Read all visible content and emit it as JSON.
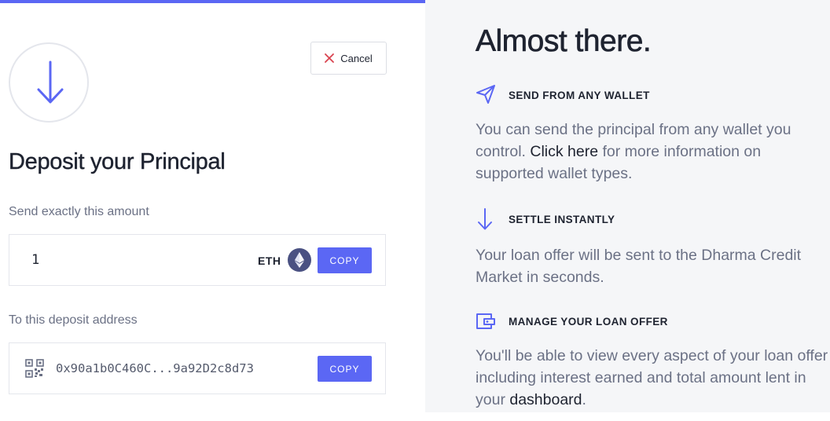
{
  "colors": {
    "accent": "#5b67f4",
    "heading": "#1e2330",
    "muted": "#6b7185",
    "right_panel_bg": "#f5f6f8",
    "cancel_icon": "#d9434f"
  },
  "deposit": {
    "icon": "arrow-down-icon",
    "cancel_label": "Cancel",
    "cancel_icon": "close-icon",
    "title": "Deposit your Principal",
    "amount_label": "Send exactly this amount",
    "amount_value": "1",
    "token_symbol": "ETH",
    "token_icon": "ethereum-icon",
    "amount_copy_label": "COPY",
    "address_label": "To this deposit address",
    "address_icon": "qr-code-icon",
    "address_value": "0x90a1b0C460C...9a92D2c8d73",
    "address_copy_label": "COPY"
  },
  "info": {
    "title": "Almost there.",
    "steps": [
      {
        "icon": "paper-plane-icon",
        "heading": "SEND FROM ANY WALLET",
        "body_before": "You can send the principal from any wallet you control. ",
        "link": "Click here",
        "body_after": " for more information on supported wallet types."
      },
      {
        "icon": "arrow-down-icon",
        "heading": "SETTLE INSTANTLY",
        "body": "Your loan offer will be sent to the Dharma Credit Market in seconds."
      },
      {
        "icon": "wallet-icon",
        "heading": "MANAGE YOUR LOAN OFFER",
        "body_before": "You'll be able to view every aspect of your loan offer including interest earned and total amount lent in your ",
        "link": "dashboard",
        "body_after": "."
      }
    ]
  }
}
